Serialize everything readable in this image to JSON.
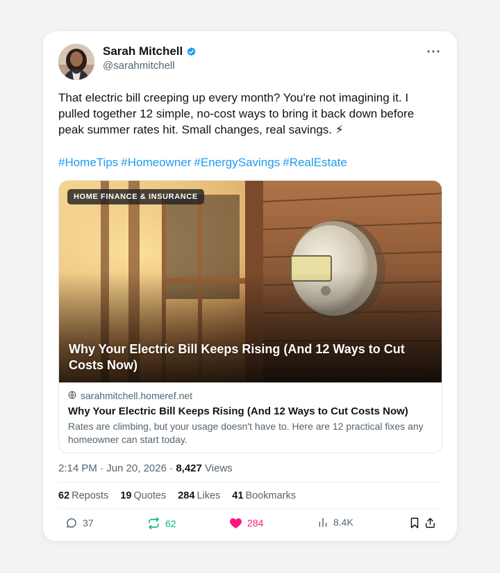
{
  "author": {
    "name": "Sarah Mitchell",
    "handle": "@sarahmitchell",
    "verified": true
  },
  "more_icon": "more-horizontal-icon",
  "post": {
    "text": "That electric bill creeping up every month? You're not imagining it. I pulled together 12 simple, no-cost ways to bring it back down before peak summer rates hit. Small changes, real savings. ⚡",
    "hashtags": [
      "#HomeTips",
      "#Homeowner",
      "#EnergySavings",
      "#RealEstate"
    ]
  },
  "link_card": {
    "badge": "HOME FINANCE & INSURANCE",
    "image_title": "Why Your Electric Bill Keeps Rising (And 12 Ways to Cut Costs Now)",
    "domain": "sarahmitchell.homeref.net",
    "title": "Why Your Electric Bill Keeps Rising (And 12 Ways to Cut Costs Now)",
    "description": "Rates are climbing, but your usage doesn't have to. Here are 12 practical fixes any homeowner can start today."
  },
  "meta": {
    "time": "2:14 PM",
    "date": "Jun 20, 2026",
    "views_count": "8,427",
    "views_label": "Views"
  },
  "stats": [
    {
      "count": "62",
      "label": "Reposts"
    },
    {
      "count": "19",
      "label": "Quotes"
    },
    {
      "count": "284",
      "label": "Likes"
    },
    {
      "count": "41",
      "label": "Bookmarks"
    }
  ],
  "actions": {
    "replies": "37",
    "reposts": "62",
    "likes": "284",
    "views": "8.4K"
  },
  "colors": {
    "link": "#1d9bf0",
    "repost_active": "#00ba7c",
    "like_active": "#f91880",
    "muted": "#536471"
  }
}
